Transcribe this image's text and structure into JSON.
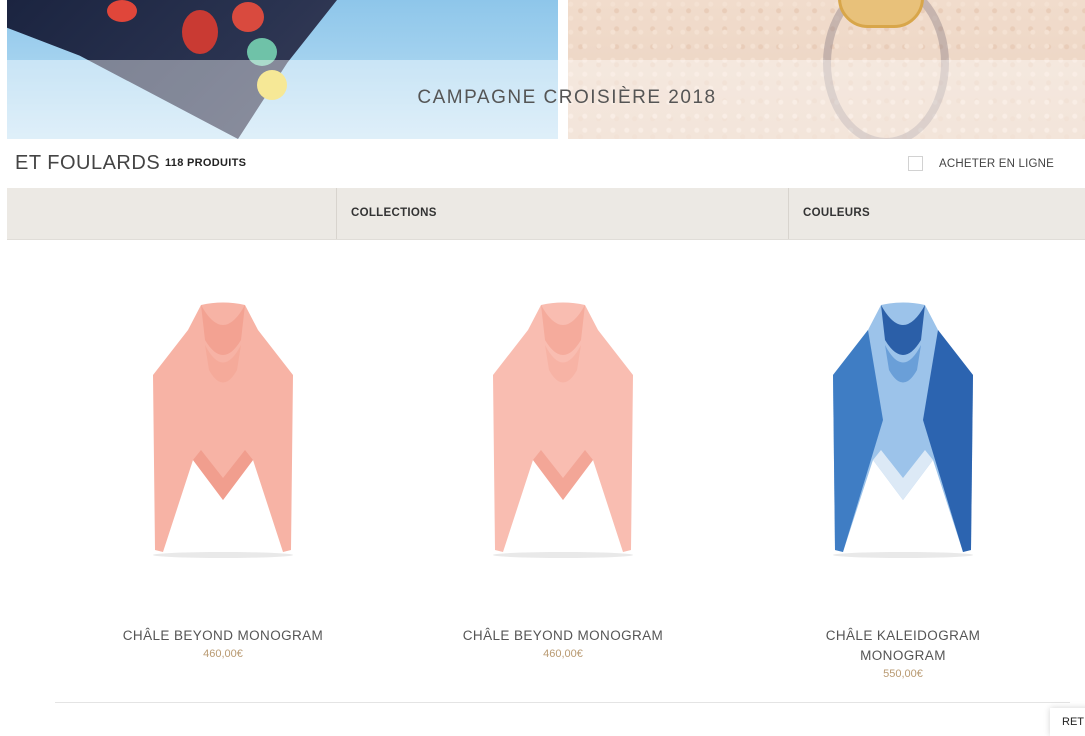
{
  "banner": {
    "title": "CAMPAGNE CROISIÈRE 2018"
  },
  "header": {
    "title": "ET FOULARDS",
    "product_count": "118 PRODUITS",
    "online_filter_label": "ACHETER EN LIGNE"
  },
  "filters": {
    "collections_label": "COLLECTIONS",
    "colors_label": "COULEURS"
  },
  "products": [
    {
      "name": "CHÂLE BEYOND MONOGRAM",
      "price": "460,00€"
    },
    {
      "name": "CHÂLE BEYOND MONOGRAM",
      "price": "460,00€"
    },
    {
      "name_line1": "CHÂLE KALEIDOGRAM",
      "name_line2": "MONOGRAM",
      "price": "550,00€"
    }
  ],
  "back_to_top": {
    "label": "RET"
  },
  "colors": {
    "filter_bar": "#ece9e4",
    "price": "#b99a72",
    "scarf_pink": "#f7b3a5",
    "scarf_blue": "#3f7dc4"
  }
}
